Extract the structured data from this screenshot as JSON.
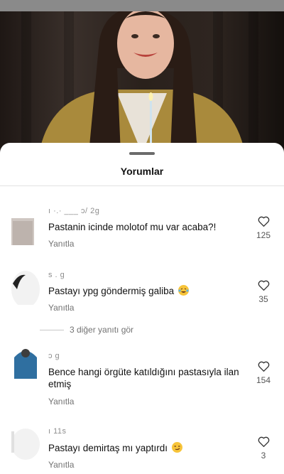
{
  "sheet": {
    "title": "Yorumlar"
  },
  "comments": [
    {
      "username": "ı  ·.· ___ ɔ/  2g",
      "text": "Pastanin icinde molotof mu var acaba?!",
      "reply_label": "Yanıtla",
      "likes": "125"
    },
    {
      "username": "s    .  g",
      "text": "Pastayı ypg göndermiş galiba",
      "reply_label": "Yanıtla",
      "likes": "35"
    },
    {
      "username": "ɔ    g",
      "text": "Bence hangi örgüte katıldığını pastasıyla ilan etmiş",
      "reply_label": "Yanıtla",
      "likes": "154"
    },
    {
      "username": "ı    11s",
      "text": "Pastayı demirtaş mı yaptırdı",
      "reply_label": "Yanıtla",
      "likes": "3"
    }
  ],
  "more_replies": "3 diğer yanıtı gör",
  "icons": {
    "like": "heart-outline-icon",
    "emoji_1": "laughing-tears-emoji-icon",
    "emoji_2": "smirk-emoji-icon"
  },
  "colors": {
    "text_primary": "#111111",
    "text_secondary": "#737373",
    "sheet_bg": "#ffffff"
  }
}
